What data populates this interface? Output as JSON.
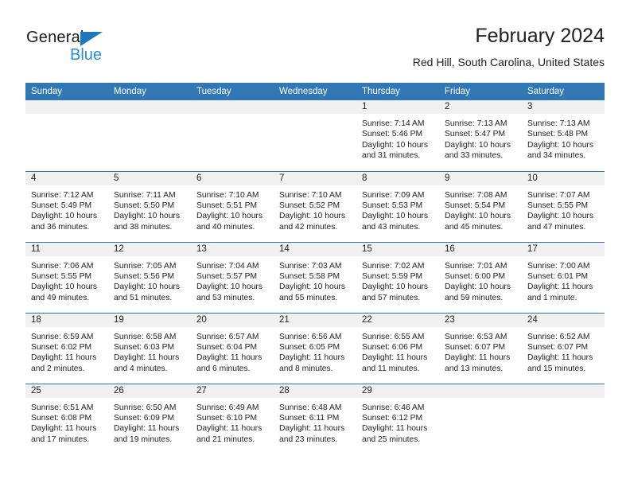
{
  "brand": {
    "name_top": "General",
    "name_bottom": "Blue",
    "triangle_icon": "blue-triangle-logo-mark",
    "color_primary": "#2b8ed6",
    "color_triangle": "#1f76bc"
  },
  "header": {
    "title": "February 2024",
    "subtitle": "Red Hill, South Carolina, United States"
  },
  "colors": {
    "header_blue": "#3177b4",
    "row_divider": "#2f76b5",
    "daynum_band": "#f0f0f0",
    "text": "#222222"
  },
  "calendar": {
    "weekday_headers": [
      "Sunday",
      "Monday",
      "Tuesday",
      "Wednesday",
      "Thursday",
      "Friday",
      "Saturday"
    ],
    "labels": {
      "sunrise": "Sunrise:",
      "sunset": "Sunset:",
      "daylight": "Daylight:"
    },
    "weeks": [
      [
        {
          "day": "",
          "info": ""
        },
        {
          "day": "",
          "info": ""
        },
        {
          "day": "",
          "info": ""
        },
        {
          "day": "",
          "info": ""
        },
        {
          "day": "1",
          "info": "Sunrise: 7:14 AM\nSunset: 5:46 PM\nDaylight: 10 hours\nand 31 minutes."
        },
        {
          "day": "2",
          "info": "Sunrise: 7:13 AM\nSunset: 5:47 PM\nDaylight: 10 hours\nand 33 minutes."
        },
        {
          "day": "3",
          "info": "Sunrise: 7:13 AM\nSunset: 5:48 PM\nDaylight: 10 hours\nand 34 minutes."
        }
      ],
      [
        {
          "day": "4",
          "info": "Sunrise: 7:12 AM\nSunset: 5:49 PM\nDaylight: 10 hours\nand 36 minutes."
        },
        {
          "day": "5",
          "info": "Sunrise: 7:11 AM\nSunset: 5:50 PM\nDaylight: 10 hours\nand 38 minutes."
        },
        {
          "day": "6",
          "info": "Sunrise: 7:10 AM\nSunset: 5:51 PM\nDaylight: 10 hours\nand 40 minutes."
        },
        {
          "day": "7",
          "info": "Sunrise: 7:10 AM\nSunset: 5:52 PM\nDaylight: 10 hours\nand 42 minutes."
        },
        {
          "day": "8",
          "info": "Sunrise: 7:09 AM\nSunset: 5:53 PM\nDaylight: 10 hours\nand 43 minutes."
        },
        {
          "day": "9",
          "info": "Sunrise: 7:08 AM\nSunset: 5:54 PM\nDaylight: 10 hours\nand 45 minutes."
        },
        {
          "day": "10",
          "info": "Sunrise: 7:07 AM\nSunset: 5:55 PM\nDaylight: 10 hours\nand 47 minutes."
        }
      ],
      [
        {
          "day": "11",
          "info": "Sunrise: 7:06 AM\nSunset: 5:55 PM\nDaylight: 10 hours\nand 49 minutes."
        },
        {
          "day": "12",
          "info": "Sunrise: 7:05 AM\nSunset: 5:56 PM\nDaylight: 10 hours\nand 51 minutes."
        },
        {
          "day": "13",
          "info": "Sunrise: 7:04 AM\nSunset: 5:57 PM\nDaylight: 10 hours\nand 53 minutes."
        },
        {
          "day": "14",
          "info": "Sunrise: 7:03 AM\nSunset: 5:58 PM\nDaylight: 10 hours\nand 55 minutes."
        },
        {
          "day": "15",
          "info": "Sunrise: 7:02 AM\nSunset: 5:59 PM\nDaylight: 10 hours\nand 57 minutes."
        },
        {
          "day": "16",
          "info": "Sunrise: 7:01 AM\nSunset: 6:00 PM\nDaylight: 10 hours\nand 59 minutes."
        },
        {
          "day": "17",
          "info": "Sunrise: 7:00 AM\nSunset: 6:01 PM\nDaylight: 11 hours\nand 1 minute."
        }
      ],
      [
        {
          "day": "18",
          "info": "Sunrise: 6:59 AM\nSunset: 6:02 PM\nDaylight: 11 hours\nand 2 minutes."
        },
        {
          "day": "19",
          "info": "Sunrise: 6:58 AM\nSunset: 6:03 PM\nDaylight: 11 hours\nand 4 minutes."
        },
        {
          "day": "20",
          "info": "Sunrise: 6:57 AM\nSunset: 6:04 PM\nDaylight: 11 hours\nand 6 minutes."
        },
        {
          "day": "21",
          "info": "Sunrise: 6:56 AM\nSunset: 6:05 PM\nDaylight: 11 hours\nand 8 minutes."
        },
        {
          "day": "22",
          "info": "Sunrise: 6:55 AM\nSunset: 6:06 PM\nDaylight: 11 hours\nand 11 minutes."
        },
        {
          "day": "23",
          "info": "Sunrise: 6:53 AM\nSunset: 6:07 PM\nDaylight: 11 hours\nand 13 minutes."
        },
        {
          "day": "24",
          "info": "Sunrise: 6:52 AM\nSunset: 6:07 PM\nDaylight: 11 hours\nand 15 minutes."
        }
      ],
      [
        {
          "day": "25",
          "info": "Sunrise: 6:51 AM\nSunset: 6:08 PM\nDaylight: 11 hours\nand 17 minutes."
        },
        {
          "day": "26",
          "info": "Sunrise: 6:50 AM\nSunset: 6:09 PM\nDaylight: 11 hours\nand 19 minutes."
        },
        {
          "day": "27",
          "info": "Sunrise: 6:49 AM\nSunset: 6:10 PM\nDaylight: 11 hours\nand 21 minutes."
        },
        {
          "day": "28",
          "info": "Sunrise: 6:48 AM\nSunset: 6:11 PM\nDaylight: 11 hours\nand 23 minutes."
        },
        {
          "day": "29",
          "info": "Sunrise: 6:46 AM\nSunset: 6:12 PM\nDaylight: 11 hours\nand 25 minutes."
        },
        {
          "day": "",
          "info": ""
        },
        {
          "day": "",
          "info": ""
        }
      ]
    ]
  }
}
